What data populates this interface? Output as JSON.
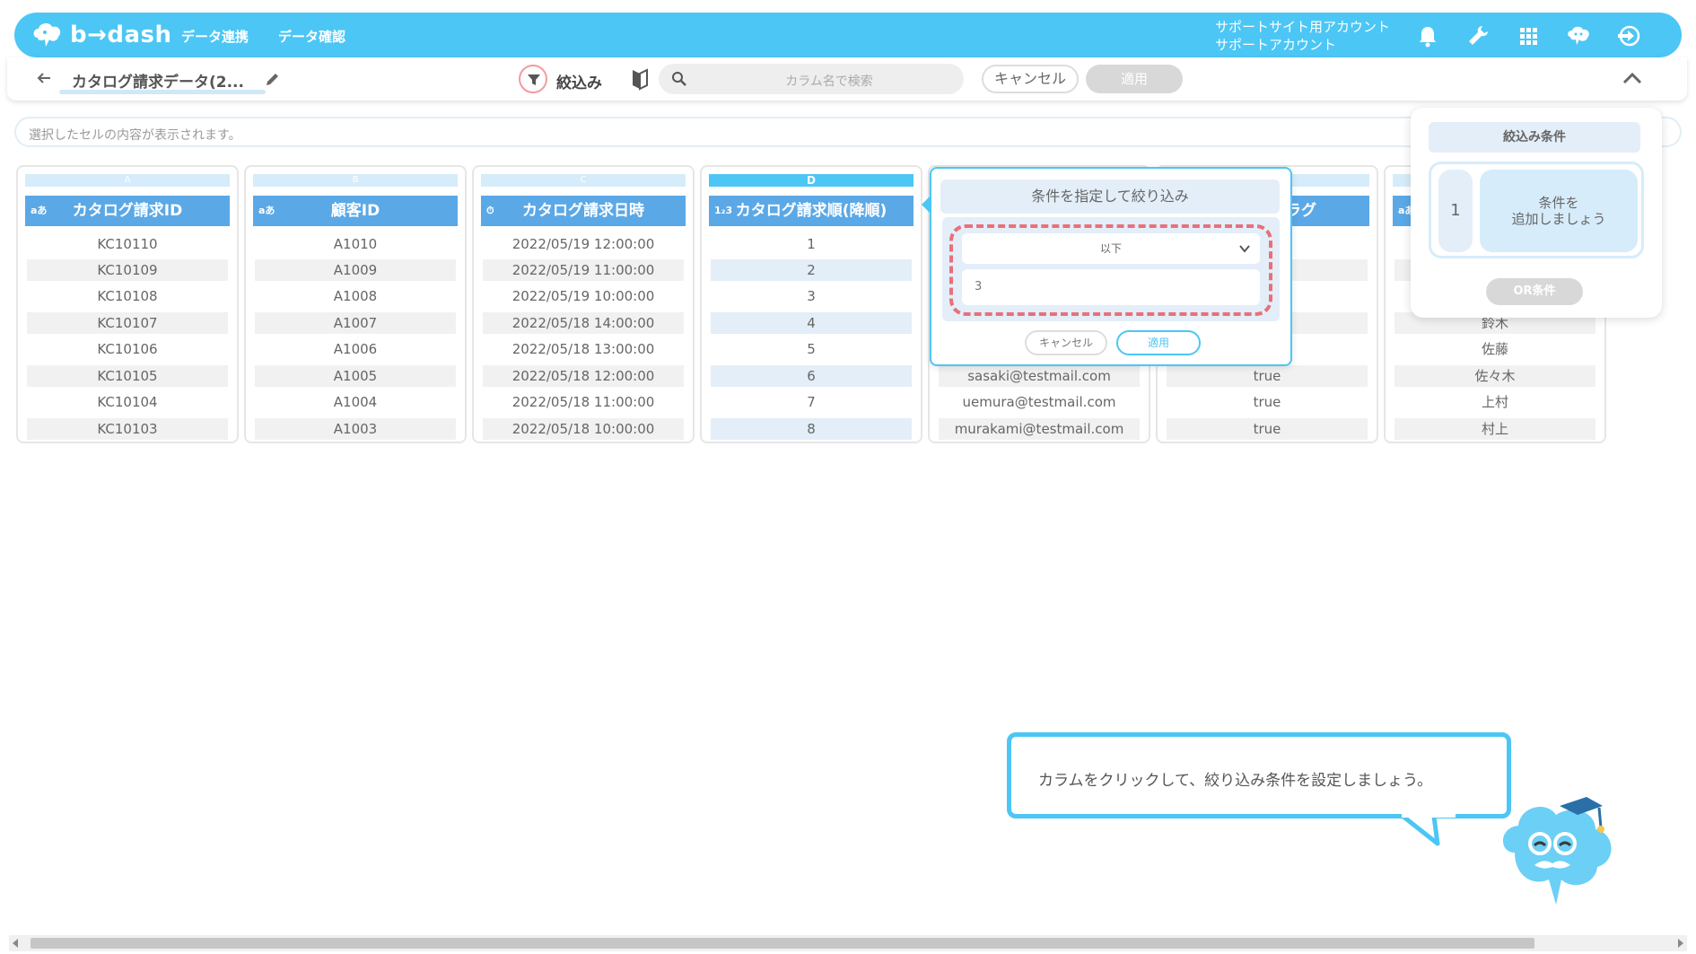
{
  "app": {
    "logo_text": "b→dash"
  },
  "nav": [
    "データ連携",
    "データ確認"
  ],
  "account": {
    "line1": "サポートサイト用アカウント",
    "line2": "サポートアカウント"
  },
  "toolbar": {
    "title": "カタログ請求データ(2...",
    "filter_label": "絞込み",
    "search_placeholder": "カラム名で検索",
    "cancel": "キャンセル",
    "apply": "適用"
  },
  "cell_bar": {
    "placeholder": "選択したセルの内容が表示されます。"
  },
  "columns": [
    {
      "letter": "A",
      "badge": "aあ",
      "header": "カタログ請求ID",
      "cells": [
        "KC10110",
        "KC10109",
        "KC10108",
        "KC10107",
        "KC10106",
        "KC10105",
        "KC10104",
        "KC10103"
      ]
    },
    {
      "letter": "B",
      "badge": "aあ",
      "header": "顧客ID",
      "cells": [
        "A1010",
        "A1009",
        "A1008",
        "A1007",
        "A1006",
        "A1005",
        "A1004",
        "A1003"
      ]
    },
    {
      "letter": "C",
      "badge": "⏱",
      "header": "カタログ請求日時",
      "cells": [
        "2022/05/19 12:00:00",
        "2022/05/19 11:00:00",
        "2022/05/19 10:00:00",
        "2022/05/18 14:00:00",
        "2022/05/18 13:00:00",
        "2022/05/18 12:00:00",
        "2022/05/18 11:00:00",
        "2022/05/18 10:00:00"
      ]
    },
    {
      "letter": "D",
      "badge": "1₂3",
      "header": "カタログ請求順(降順)",
      "cells": [
        "1",
        "2",
        "3",
        "4",
        "5",
        "6",
        "7",
        "8"
      ]
    },
    {
      "letter": "",
      "badge": "",
      "header": "",
      "cells": [
        "",
        "",
        "",
        "",
        "",
        "sasaki@testmail.com",
        "uemura@testmail.com",
        "murakami@testmail.com"
      ]
    },
    {
      "letter": "",
      "badge": "",
      "header": "フラグ",
      "cells": [
        "",
        "",
        "",
        "",
        "",
        "true",
        "true",
        "true"
      ]
    },
    {
      "letter": "",
      "badge": "aあ",
      "header": "",
      "cells": [
        "",
        "",
        "",
        "鈴木",
        "佐藤",
        "佐々木",
        "上村",
        "村上"
      ]
    }
  ],
  "filter_popup": {
    "title": "条件を指定して絞り込み",
    "operator": "以下",
    "value": "3",
    "cancel": "キャンセル",
    "apply": "適用"
  },
  "condition_panel": {
    "title": "絞込み条件",
    "number": "1",
    "add_line1": "条件を",
    "add_line2": "追加しましょう",
    "or_button": "OR条件"
  },
  "tooltip": {
    "text": "カラムをクリックして、絞り込み条件を設定しましょう。"
  },
  "colors": {
    "brand": "#4cc6f5",
    "header_blue": "#5ba8e6",
    "highlight": "#e8707a"
  }
}
